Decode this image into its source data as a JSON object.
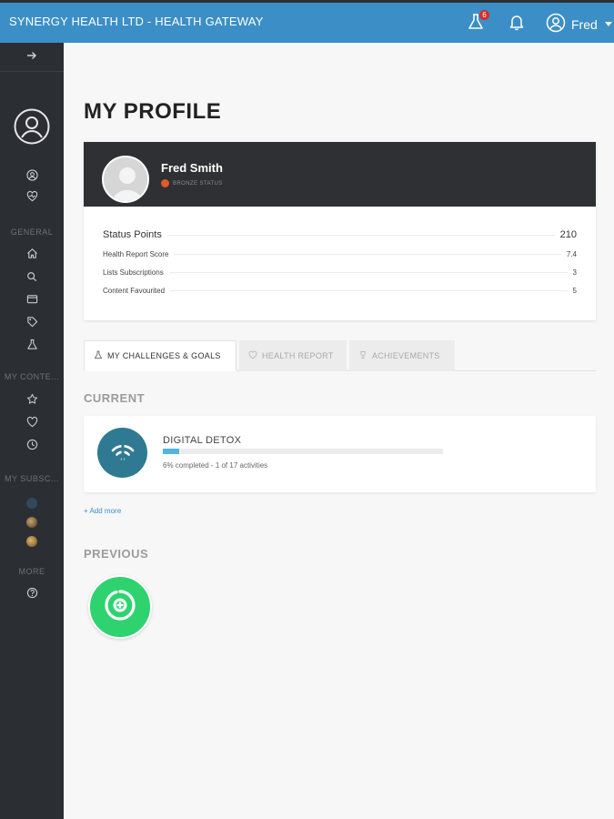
{
  "header": {
    "app_title": "SYNERGY HEALTH LTD - HEALTH GATEWAY",
    "challenges_badge_count": "6",
    "user_name": "Fred"
  },
  "sidebar": {
    "headings": {
      "general": "GENERAL",
      "my_content": "MY CONTE...",
      "my_subscriptions": "MY SUBSC...",
      "more": "MORE"
    }
  },
  "page": {
    "title": "MY PROFILE"
  },
  "profile": {
    "name": "Fred Smith",
    "status": "BRONZE STATUS",
    "stats": [
      {
        "label": "Status Points",
        "value": "210"
      },
      {
        "label": "Health Report Score",
        "value": "7.4"
      },
      {
        "label": "Lists Subscriptions",
        "value": "3"
      },
      {
        "label": "Content Favourited",
        "value": "5"
      }
    ]
  },
  "tabs": [
    {
      "label": "MY CHALLENGES & GOALS",
      "icon": "flask-icon",
      "active": true
    },
    {
      "label": "HEALTH REPORT",
      "icon": "heart-icon",
      "active": false
    },
    {
      "label": "ACHIEVEMENTS",
      "icon": "trophy-icon",
      "active": false
    }
  ],
  "current": {
    "heading": "CURRENT",
    "challenge": {
      "name": "DIGITAL DETOX",
      "progress_fraction": 0.06,
      "percent_text": "6% completed",
      "activities_text": " - 1 of 17 activities"
    },
    "add_more": "+ Add more"
  },
  "previous": {
    "heading": "PREVIOUS"
  },
  "colors": {
    "topbar": "#3b8fc6",
    "sidebar": "#2b2e33",
    "progress": "#4fb6e0",
    "status_dot": "#e05a2b",
    "previous_badge": "#2ed36f"
  }
}
